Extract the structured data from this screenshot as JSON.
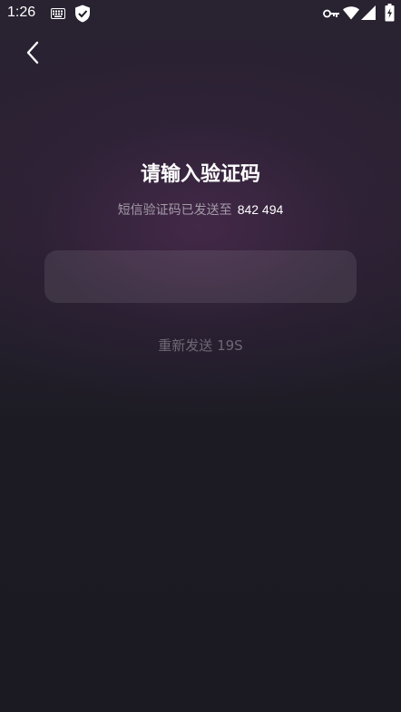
{
  "status_bar": {
    "time": "1:26",
    "icons": [
      "keyboard-icon",
      "shield-icon",
      "vpn-key-icon",
      "wifi-icon",
      "signal-icon",
      "battery-icon"
    ]
  },
  "header": {
    "back_icon": "chevron-left-icon"
  },
  "main": {
    "title": "请输入验证码",
    "subtitle_prefix": "短信验证码已发送至",
    "phone": "842 494",
    "code_input_value": "",
    "resend_label": "重新发送 19S"
  },
  "colors": {
    "background": "#1b1a22",
    "accent_glow": "#58305c",
    "text_primary": "#ffffff",
    "text_secondary": "#a49ba8",
    "text_disabled": "#6e6874",
    "input_bg": "#2f2a36"
  }
}
